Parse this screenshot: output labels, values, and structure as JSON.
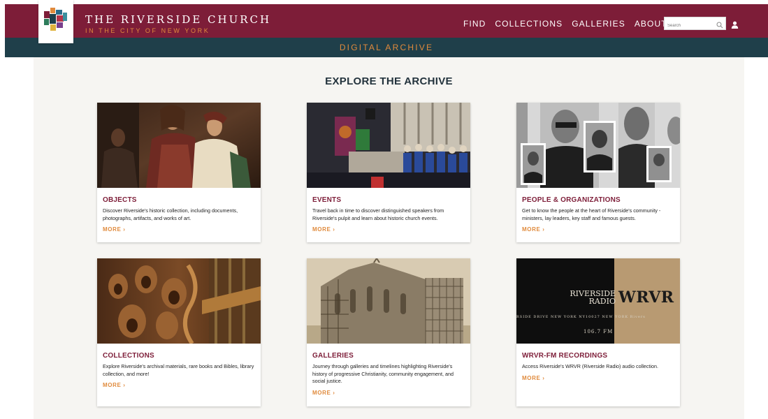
{
  "brand": {
    "title": "THE RIVERSIDE CHURCH",
    "subtitle": "IN THE CITY OF NEW YORK"
  },
  "nav": {
    "items": [
      {
        "label": "FIND"
      },
      {
        "label": "COLLECTIONS"
      },
      {
        "label": "GALLERIES"
      },
      {
        "label": "ABOUT"
      }
    ],
    "about_caret": "▾"
  },
  "search": {
    "placeholder": "Search"
  },
  "subheader": {
    "title": "DIGITAL ARCHIVE"
  },
  "main": {
    "title": "EXPLORE THE ARCHIVE",
    "cards": [
      {
        "title": "OBJECTS",
        "description": "Discover Riverside's historic collection, including documents, photographs, artifacts, and works of art.",
        "more": "MORE ›"
      },
      {
        "title": "EVENTS",
        "description": "Travel back in time to discover distinguished speakers from Riverside's pulpit and learn about historic church events.",
        "more": "MORE ›"
      },
      {
        "title": "PEOPLE & ORGANIZATIONS",
        "description": "Get to know the people at the heart of Riverside's community - ministers, lay leaders, key staff and famous guests.",
        "more": "MORE ›"
      },
      {
        "title": "COLLECTIONS",
        "description": "Explore Riverside's archival materials, rare books and Bibles, library collection, and more!",
        "more": "MORE ›"
      },
      {
        "title": "GALLERIES",
        "description": "Journey through galleries and timelines highlighting Riverside's history of progressive Christianity, community engagement, and social justice.",
        "more": "MORE ›"
      },
      {
        "title": "WRVR-FM RECORDINGS",
        "description": "Access Riverside's WRVR (Riverside Radio) audio collection.",
        "more": "MORE ›",
        "image_text": {
          "line1": "RIVERSIDE",
          "line2": "RADIO",
          "call": "WRVR",
          "strip": "RSIDE DRIVE   NEW YORK   NY10027   NEW YORK   Rivers",
          "freq": "106.7 FM"
        }
      }
    ]
  },
  "colors": {
    "brand_maroon": "#7d1d38",
    "dark_teal": "#1f3f4a",
    "accent_orange": "#e08a3c"
  }
}
